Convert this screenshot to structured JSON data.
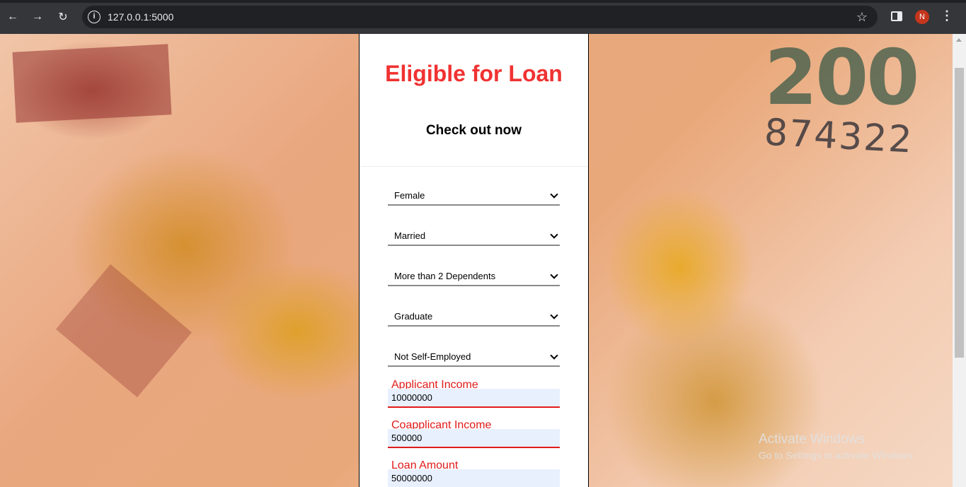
{
  "browser": {
    "url": "127.0.0.1:5000",
    "profile_initial": "N"
  },
  "background": {
    "note_value": "200",
    "serial": "874322",
    "watermark_title": "Activate Windows",
    "watermark_subtitle": "Go to Settings to activate Windows."
  },
  "form": {
    "title": "Eligible for Loan",
    "subtitle": "Check out now",
    "selects": {
      "gender": "Female",
      "married": "Married",
      "dependents": "More than 2 Dependents",
      "education": "Graduate",
      "self_employed": "Not Self-Employed"
    },
    "applicant_income": {
      "label": "Applicant Income",
      "value": "10000000"
    },
    "coapplicant_income": {
      "label": "Coapplicant Income",
      "value": "500000"
    },
    "loan_amount": {
      "label": "Loan Amount",
      "value": "50000000"
    }
  },
  "colors": {
    "accent_red": "#f03232",
    "label_red": "#e11b1b",
    "autofill_bg": "#e8f0fe"
  }
}
